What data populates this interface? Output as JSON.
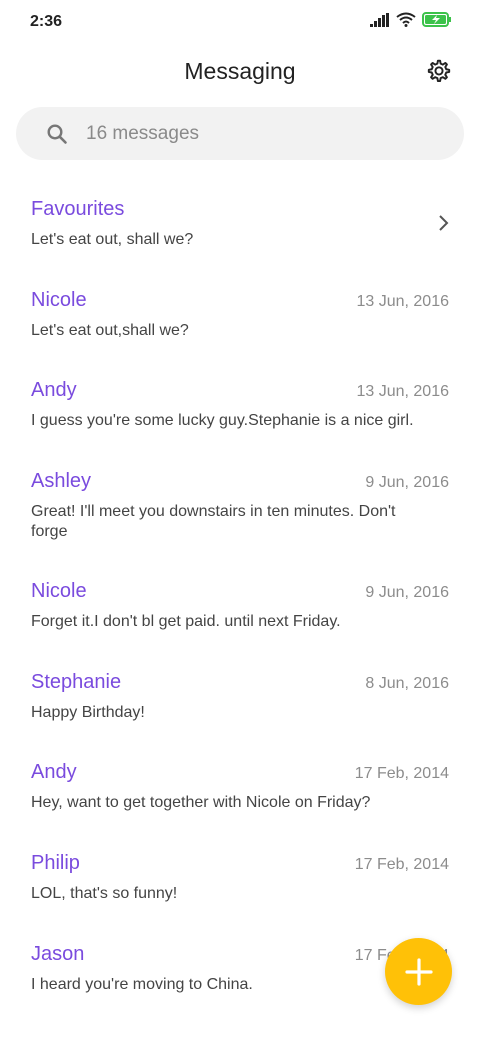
{
  "status_bar": {
    "time": "2:36",
    "icons": [
      "signal-icon",
      "wifi-icon",
      "battery-charging-icon"
    ]
  },
  "header": {
    "title": "Messaging",
    "settings_icon": "gear-icon"
  },
  "search": {
    "placeholder": "16 messages",
    "icon": "search-icon"
  },
  "favourites": {
    "name": "Favourites",
    "preview": "Let's eat out, shall we?"
  },
  "conversations": [
    {
      "name": "Nicole",
      "date": "13 Jun, 2016",
      "preview": "Let's eat out,shall we?"
    },
    {
      "name": "Andy",
      "date": "13 Jun, 2016",
      "preview": "I guess you're some lucky guy.Stephanie is a nice girl."
    },
    {
      "name": "Ashley",
      "date": "9 Jun, 2016",
      "preview": "Great! I'll meet you downstairs in ten minutes. Don't forge"
    },
    {
      "name": "Nicole",
      "date": "9 Jun, 2016",
      "preview": "Forget it.I don't bl get paid. until next Friday."
    },
    {
      "name": "Stephanie",
      "date": "8 Jun, 2016",
      "preview": "Happy Birthday!"
    },
    {
      "name": "Andy",
      "date": "17 Feb, 2014",
      "preview": "Hey, want to get together with Nicole on Friday?"
    },
    {
      "name": "Philip",
      "date": "17 Feb, 2014",
      "preview": "LOL, that's so funny!"
    },
    {
      "name": "Jason",
      "date": "17 Feb, 2014",
      "preview": "I heard you're moving to China."
    }
  ],
  "fab": {
    "icon": "plus-icon"
  },
  "colors": {
    "accent": "#7a4bde",
    "fab": "#ffc107",
    "battery": "#3cc24a"
  }
}
